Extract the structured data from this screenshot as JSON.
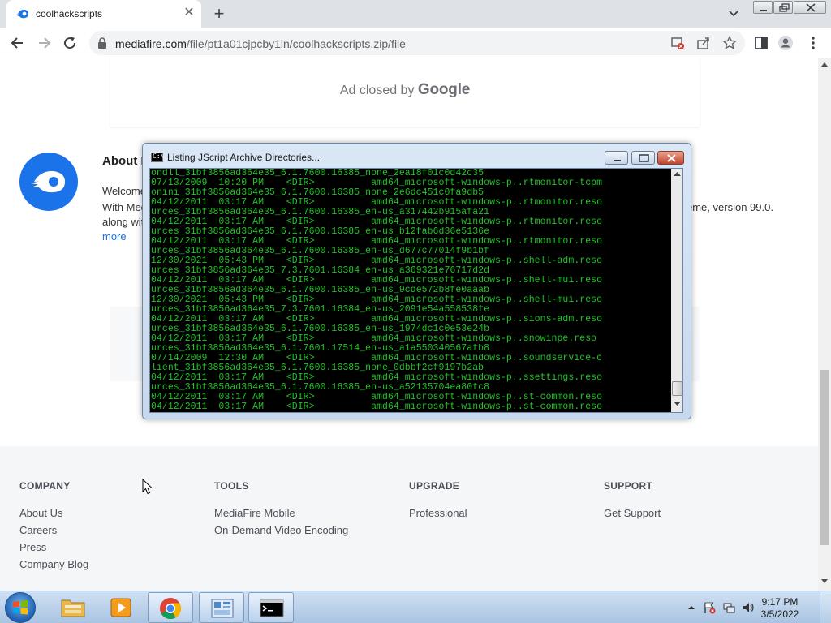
{
  "browser": {
    "tab_title": "coolhackscripts",
    "tab_close": "✕",
    "new_tab": "+",
    "url_domain": "mediafire.com",
    "url_path": "/file/pt1a01cjpcby1ln/coolhackscripts.zip/file"
  },
  "ad": {
    "closed_by": "Ad closed by",
    "brand": "Google"
  },
  "about": {
    "title": "About M",
    "line1": "Welcome",
    "line2": "With Med",
    "line3": "along wit",
    "version_text": "eme, version 99.0.",
    "more": "more"
  },
  "footer": {
    "columns": [
      {
        "heading": "COMPANY",
        "links": [
          "About Us",
          "Careers",
          "Press",
          "Company Blog"
        ]
      },
      {
        "heading": "TOOLS",
        "links": [
          "MediaFire Mobile",
          "On-Demand Video Encoding"
        ]
      },
      {
        "heading": "UPGRADE",
        "links": [
          "Professional"
        ]
      },
      {
        "heading": "SUPPORT",
        "links": [
          "Get Support"
        ]
      }
    ]
  },
  "console": {
    "title": "Listing JScript Archive Directories...",
    "lines": [
      "ondll_31bf3856ad364e35_6.1.7600.16385_none_2ea18f01c0d42c35",
      "07/13/2009  10:20 PM    <DIR>          amd64_microsoft-windows-p..rtmonitor-tcpm",
      "onini_31bf3856ad364e35_6.1.7600.16385_none_2e6dc451c0fa9db5",
      "04/12/2011  03:17 AM    <DIR>          amd64_microsoft-windows-p..rtmonitor.reso",
      "urces_31bf3856ad364e35_6.1.7600.16385_en-us_a317442b915afa21",
      "04/12/2011  03:17 AM    <DIR>          amd64_microsoft-windows-p..rtmonitor.reso",
      "urces_31bf3856ad364e35_6.1.7600.16385_en-us_b12fab6d36e5136e",
      "04/12/2011  03:17 AM    <DIR>          amd64_microsoft-windows-p..rtmonitor.reso",
      "urces_31bf3856ad364e35_6.1.7600.16385_en-us_d677c77014f9b1bf",
      "12/30/2021  05:43 PM    <DIR>          amd64_microsoft-windows-p..shell-adm.reso",
      "urces_31bf3856ad364e35_7.3.7601.16384_en-us_a369321e76717d2d",
      "04/12/2011  03:17 AM    <DIR>          amd64_microsoft-windows-p..shell-mui.reso",
      "urces_31bf3856ad364e35_6.1.7600.16385_en-us_9cde572b8fe0aaab",
      "12/30/2021  05:43 PM    <DIR>          amd64_microsoft-windows-p..shell-mui.reso",
      "urces_31bf3856ad364e35_7.3.7601.16384_en-us_2091e54a558538fe",
      "04/12/2011  03:17 AM    <DIR>          amd64_microsoft-windows-p..sions-adm.reso",
      "urces_31bf3856ad364e35_6.1.7600.16385_en-us_1974dc1c0e53e24b",
      "04/12/2011  03:17 AM    <DIR>          amd64_microsoft-windows-p..snowinpe.reso",
      "urces_31bf3856ad364e35_6.1.7601.17514_en-us_a1a550340567afb8",
      "07/14/2009  12:30 AM    <DIR>          amd64_microsoft-windows-p..soundservice-c",
      "lient_31bf3856ad364e35_6.1.7600.16385_none_0dbbf2cf9197b2ab",
      "04/12/2011  03:17 AM    <DIR>          amd64_microsoft-windows-p..ssettings.reso",
      "urces_31bf3856ad364e35_6.1.7600.16385_en-us_a52135704ea80fc8",
      "04/12/2011  03:17 AM    <DIR>          amd64_microsoft-windows-p..st-common.reso",
      "04/12/2011  03:17 AM    <DIR>          amd64_microsoft-windows-p..st-common.reso"
    ]
  },
  "taskbar": {
    "apps": [
      "file-explorer",
      "media-player",
      "chrome",
      "control-panel",
      "command-prompt"
    ],
    "time": "9:17 PM",
    "date": "3/5/2022"
  },
  "colors": {
    "console_text": "#21c226",
    "mediafire_blue": "#1a73e8"
  }
}
